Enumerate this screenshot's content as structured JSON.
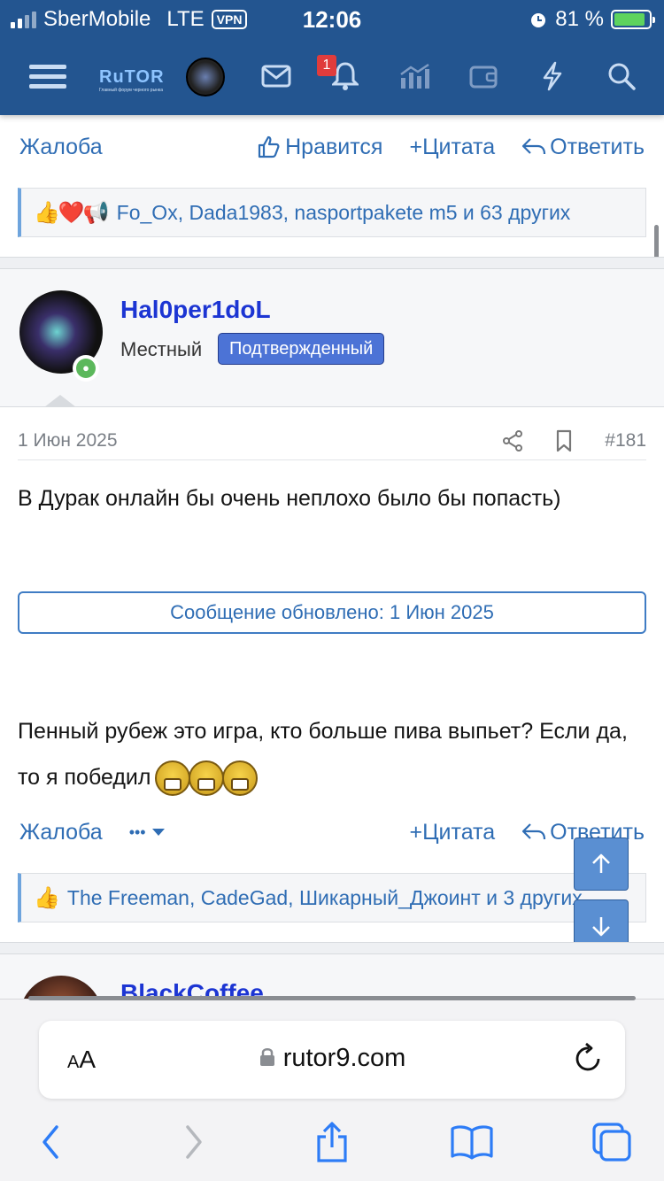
{
  "status": {
    "carrier": "SberMobile",
    "network": "LTE",
    "vpn": "VPN",
    "time": "12:06",
    "battery": "81 %"
  },
  "header": {
    "logo_text": "RuTOR",
    "logo_sub": "Главный форум черного рынка",
    "notif_count": "1"
  },
  "post1": {
    "complaint": "Жалоба",
    "like": "Нравится",
    "quote": "Цитата",
    "reply": "Ответить",
    "reactions_text": "Fo_Ox, Dada1983, nasportpakete m5 и 63 других"
  },
  "post2": {
    "username": "Hal0per1doL",
    "user_title": "Местный",
    "user_badge": "Подтвержденный",
    "date": "1 Июн 2025",
    "number": "#181",
    "text1": "В Дурак онлайн бы очень неплохо было бы попасть)",
    "updated": "Сообщение обновлено: 1 Июн 2025",
    "text2": "Пенный рубеж это игра, кто больше пива выпьет? Если да, то я победил",
    "complaint": "Жалоба",
    "more": "•••",
    "quote": "Цитата",
    "reply": "Ответить",
    "reactions_text": "The Freeman, CadeGad, Шикарный_Джоинт и 3 других"
  },
  "post3": {
    "username": "BlackCoffee_"
  },
  "safari": {
    "aa_small": "A",
    "aa_big": "A",
    "url": "rutor9.com"
  },
  "colors": {
    "header": "#235590",
    "link": "#2f6db4",
    "username": "#1c35d3",
    "badge": "#4c73d6"
  }
}
